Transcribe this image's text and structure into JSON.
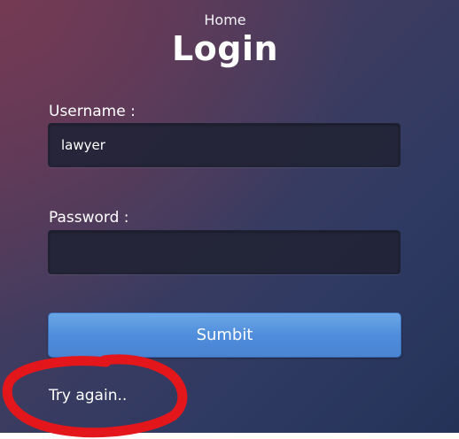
{
  "nav": {
    "home_label": "Home"
  },
  "page": {
    "title": "Login"
  },
  "form": {
    "username_label": "Username :",
    "username_value": "lawyer",
    "password_label": "Password :",
    "password_value": "",
    "submit_label": "Sumbit"
  },
  "status": {
    "message": "Try again.."
  },
  "colors": {
    "annotation_red": "#e3161b",
    "button_blue": "#4e8cdb",
    "field_dark": "#22243a"
  }
}
